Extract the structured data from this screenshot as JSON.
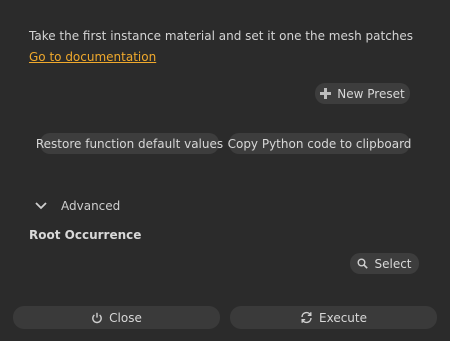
{
  "description": "Take the first instance material and set it one the mesh patches",
  "doc_link": "Go to documentation",
  "presets": {
    "new_preset_label": "New Preset",
    "icon": "plus-icon"
  },
  "actions": {
    "restore_label": "Restore function default values",
    "copy_python_label": "Copy Python code to clipboard"
  },
  "advanced": {
    "label": "Advanced",
    "icon": "chevron-down-icon"
  },
  "parameters": {
    "root_occurrence_label": "Root Occurrence",
    "select_label": "Select",
    "select_icon": "search-icon"
  },
  "footer": {
    "close_label": "Close",
    "close_icon": "power-icon",
    "execute_label": "Execute",
    "execute_icon": "refresh-icon"
  },
  "colors": {
    "background": "#2b2b2b",
    "button": "#3d3d3d",
    "link": "#f0a92c",
    "text": "#d6d6d6"
  }
}
